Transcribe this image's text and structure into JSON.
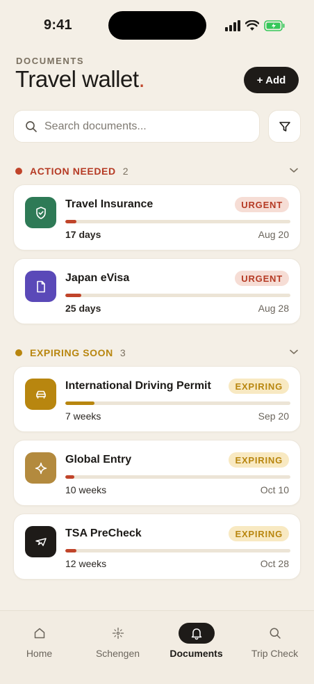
{
  "status_bar": {
    "time": "9:41"
  },
  "header": {
    "eyebrow": "DOCUMENTS",
    "title": "Travel wallet",
    "title_dot": ".",
    "add_button": "+ Add"
  },
  "search": {
    "placeholder": "Search documents..."
  },
  "sections": [
    {
      "label": "ACTION NEEDED",
      "count": "2",
      "color": "#c0442a",
      "items": [
        {
          "name": "Travel Insurance",
          "badge": "URGENT",
          "remaining": "17 days",
          "date": "Aug 20",
          "progress": 0.05,
          "icon": "shield-icon",
          "icon_bg": "#2e7a56"
        },
        {
          "name": "Japan eVisa",
          "badge": "URGENT",
          "remaining": "25 days",
          "date": "Aug 28",
          "progress": 0.07,
          "icon": "document-icon",
          "icon_bg": "#5a49b8"
        }
      ]
    },
    {
      "label": "EXPIRING SOON",
      "count": "3",
      "color": "#b8860f",
      "items": [
        {
          "name": "International Driving Permit",
          "badge": "EXPIRING",
          "remaining": "7 weeks",
          "date": "Sep 20",
          "progress": 0.13,
          "icon": "car-icon",
          "icon_bg": "#b8860f"
        },
        {
          "name": "Global Entry",
          "badge": "EXPIRING",
          "remaining": "10 weeks",
          "date": "Oct 10",
          "progress": 0.04,
          "icon": "sparkle-icon",
          "icon_bg": "#b38a3e"
        },
        {
          "name": "TSA PreCheck",
          "badge": "EXPIRING",
          "remaining": "12 weeks",
          "date": "Oct 28",
          "progress": 0.05,
          "icon": "plane-icon",
          "icon_bg": "#1e1b18"
        }
      ]
    }
  ],
  "tab_bar": {
    "tabs": [
      {
        "label": "Home",
        "icon": "home-icon",
        "active": false
      },
      {
        "label": "Schengen",
        "icon": "stars-icon",
        "active": false
      },
      {
        "label": "Documents",
        "icon": "bell-icon",
        "active": true
      },
      {
        "label": "Trip Check",
        "icon": "search-icon",
        "active": false
      }
    ]
  },
  "colors": {
    "background": "#f4efe6",
    "accent_red": "#c0442a",
    "accent_amber": "#b8860f",
    "dark": "#1e1b18"
  }
}
